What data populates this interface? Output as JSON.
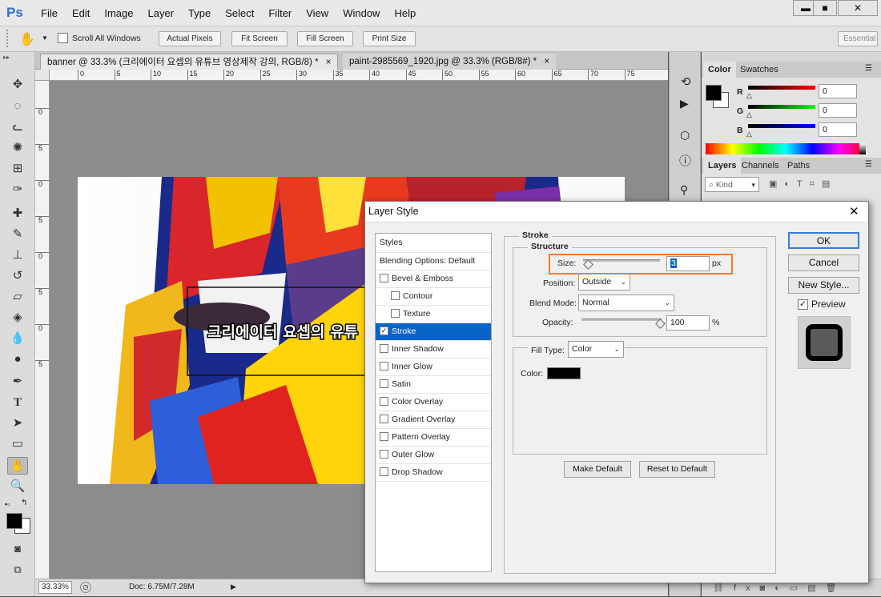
{
  "app": {
    "logo": "Ps"
  },
  "menu": [
    "File",
    "Edit",
    "Image",
    "Layer",
    "Type",
    "Select",
    "Filter",
    "View",
    "Window",
    "Help"
  ],
  "window_controls": {
    "minimize": "▬",
    "maximize": "■",
    "close": "✕"
  },
  "options_bar": {
    "scroll_all_windows": "Scroll All Windows",
    "actual_pixels": "Actual Pixels",
    "fit_screen": "Fit Screen",
    "fill_screen": "Fill Screen",
    "print_size": "Print Size",
    "workspace": "Essential"
  },
  "tabs": [
    {
      "label": "banner @ 33.3% (크리에이터 요셉의 유튜브 영상제작 강의, RGB/8) *",
      "close": "×"
    },
    {
      "label": "paint-2985569_1920.jpg @ 33.3% (RGB/8#) *",
      "close": "×"
    }
  ],
  "ruler_top": [
    "0",
    "5",
    "10",
    "15",
    "20",
    "25",
    "30",
    "35",
    "40",
    "45",
    "50",
    "55",
    "60",
    "65",
    "70",
    "75"
  ],
  "ruler_left": [
    "0",
    "5",
    "0",
    "5",
    "0",
    "5",
    "0",
    "5"
  ],
  "canvas": {
    "banner_text": "크리에이터 요셉의 유튜"
  },
  "status": {
    "zoom": "33.33%",
    "doc": "Doc: 6.75M/7.28M"
  },
  "color_panel": {
    "tabs": [
      "Color",
      "Swatches"
    ],
    "channels": [
      {
        "label": "R",
        "value": "0",
        "color": "#ff0000"
      },
      {
        "label": "G",
        "value": "0",
        "color": "#00ff00"
      },
      {
        "label": "B",
        "value": "0",
        "color": "#0000ff"
      }
    ]
  },
  "layers_panel": {
    "tabs": [
      "Layers",
      "Channels",
      "Paths"
    ],
    "kind": "Kind"
  },
  "dialog": {
    "title": "Layer Style",
    "close": "✕",
    "styles_header": "Styles",
    "blending": "Blending Options: Default",
    "items": [
      {
        "label": "Bevel & Emboss",
        "checked": false,
        "indent": false
      },
      {
        "label": "Contour",
        "checked": false,
        "indent": true
      },
      {
        "label": "Texture",
        "checked": false,
        "indent": true
      },
      {
        "label": "Stroke",
        "checked": true,
        "indent": false,
        "selected": true
      },
      {
        "label": "Inner Shadow",
        "checked": false,
        "indent": false
      },
      {
        "label": "Inner Glow",
        "checked": false,
        "indent": false
      },
      {
        "label": "Satin",
        "checked": false,
        "indent": false
      },
      {
        "label": "Color Overlay",
        "checked": false,
        "indent": false
      },
      {
        "label": "Gradient Overlay",
        "checked": false,
        "indent": false
      },
      {
        "label": "Pattern Overlay",
        "checked": false,
        "indent": false
      },
      {
        "label": "Outer Glow",
        "checked": false,
        "indent": false
      },
      {
        "label": "Drop Shadow",
        "checked": false,
        "indent": false
      }
    ],
    "stroke": {
      "group_title": "Stroke",
      "structure_title": "Structure",
      "size_label": "Size:",
      "size_value": "3",
      "size_unit": "px",
      "position_label": "Position:",
      "position_value": "Outside",
      "blend_label": "Blend Mode:",
      "blend_value": "Normal",
      "opacity_label": "Opacity:",
      "opacity_value": "100",
      "opacity_unit": "%",
      "fill_type_label": "Fill Type:",
      "fill_type_value": "Color",
      "color_label": "Color:",
      "stroke_color": "#000000",
      "make_default": "Make Default",
      "reset_default": "Reset to Default"
    },
    "buttons": {
      "ok": "OK",
      "cancel": "Cancel",
      "new_style": "New Style...",
      "preview": "Preview"
    },
    "highlight_color": "#f07a2a",
    "selected_color": "#0a64c8"
  }
}
